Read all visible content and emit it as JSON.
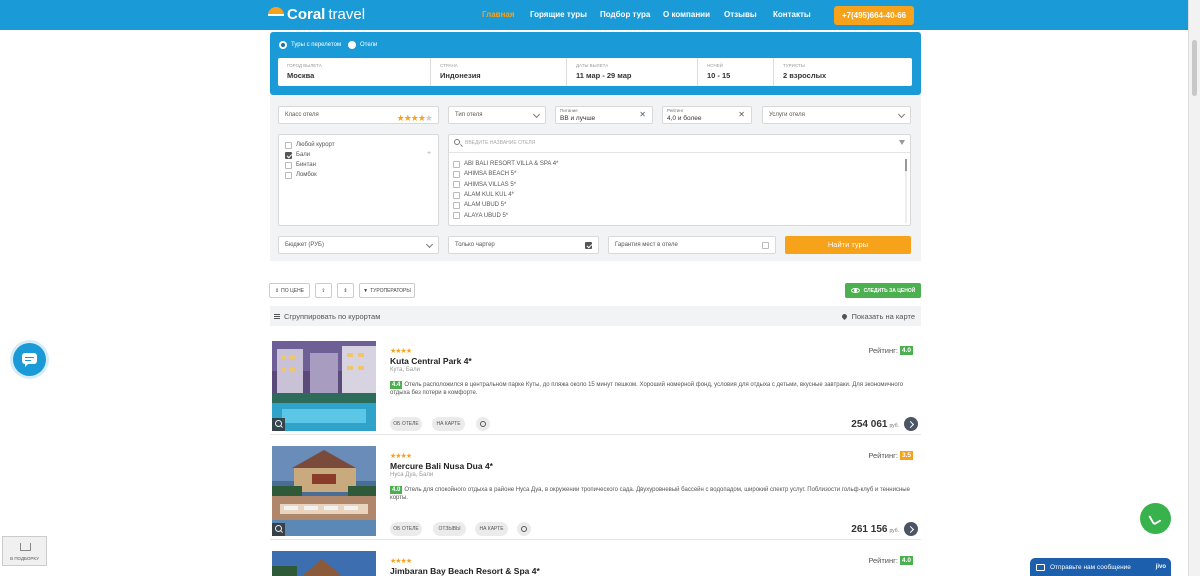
{
  "header": {
    "logo_text_bold": "Coral",
    "logo_text_light": "travel",
    "nav": [
      "Главная",
      "Горящие туры",
      "Подбор тура",
      "О компании",
      "Отзывы",
      "Контакты"
    ],
    "phone": "+7(495)664-40-66",
    "accent": "#f7a21b",
    "brand": "#1a9ad6"
  },
  "search": {
    "radio_flight": "Туры с перелетом",
    "radio_hotels": "Отели",
    "fields": [
      {
        "label": "Город вылета",
        "value": "Москва"
      },
      {
        "label": "Страна",
        "value": "Индонезия"
      },
      {
        "label": "Даты вылета",
        "value": "11 мар - 29 мар"
      },
      {
        "label": "Ночей",
        "value": "10 - 15"
      },
      {
        "label": "Туристы",
        "value": "2 взрослых"
      }
    ]
  },
  "filters": {
    "hotel_class": "Класс отеля",
    "hotel_type": "Тип отеля",
    "meal_label": "Питание",
    "meal_value": "BB и лучше",
    "rating_label": "Рейтинг",
    "rating_value": "4,0 и более",
    "services": "Услуги отеля",
    "resorts": [
      {
        "name": "Любой курорт",
        "checked": false
      },
      {
        "name": "Бали",
        "checked": true
      },
      {
        "name": "Бинтан",
        "checked": false
      },
      {
        "name": "Ломбок",
        "checked": false
      }
    ],
    "hotel_search_placeholder": "Введите название отеля",
    "hotels": [
      "ABI BALI RESORT VILLA & SPA 4*",
      "AHIMSA BEACH 5*",
      "AHIMSA VILLAS 5*",
      "ALAM KUL KUL 4*",
      "ALAM UBUD 5*",
      "ALAYA UBUD 5*"
    ],
    "budget": "Бюджет (РУБ)",
    "charter_only": "Только чартер",
    "guarantee": "Гарантия мест в отеле",
    "find_button": "Найти туры"
  },
  "toolbar": {
    "sort_price": "ПО ЦЕНЕ",
    "operators": "ТУРОПЕРАТОРЫ",
    "follow_price": "СЛЕДИТЬ ЗА ЦЕНОЙ",
    "group_by": "Сгруппировать по курортам",
    "show_map": "Показать на карте"
  },
  "cards": [
    {
      "stars": "★★★★",
      "name": "Kuta Central Park 4*",
      "location": "Кута, Бали",
      "score": "4.4",
      "description": "Отель расположился в центральном парке Куты, до пляжа около 15 минут пешком. Хороший номерной фонд, условия для отдыха с детьми, вкусные завтраки. Для экономичного отдыха без потери в комфорте.",
      "rating_label": "Рейтинг:",
      "rating": "4.0",
      "rating_color": "green",
      "btn_about": "ОБ ОТЕЛЕ",
      "btn_map": "НА КАРТЕ",
      "price": "254 061",
      "currency": "руб."
    },
    {
      "stars": "★★★★",
      "name": "Mercure Bali Nusa Dua 4*",
      "location": "Нуса Дуа, Бали",
      "score": "4.0",
      "description": "Отель для спокойного отдыха в районе Нуса Дуа, в окружении тропического сада. Двухуровневый бассейн с водопадом, широкий спектр услуг. Поблизости гольф-клуб и теннисные корты.",
      "rating_label": "Рейтинг:",
      "rating": "3.5",
      "rating_color": "orange",
      "btn_about": "ОБ ОТЕЛЕ",
      "btn_reviews": "ОТЗЫВЫ",
      "btn_map": "НА КАРТЕ",
      "price": "261 156",
      "currency": "руб."
    },
    {
      "stars": "★★★★",
      "name": "Jimbaran Bay Beach Resort & Spa 4*",
      "rating_label": "Рейтинг:",
      "rating": "4.0",
      "rating_color": "green"
    }
  ],
  "widgets": {
    "cart_label": "В ПОДБОРКУ",
    "jivo_text": "Отправьте нам сообщение",
    "jivo_brand": "jivo"
  }
}
